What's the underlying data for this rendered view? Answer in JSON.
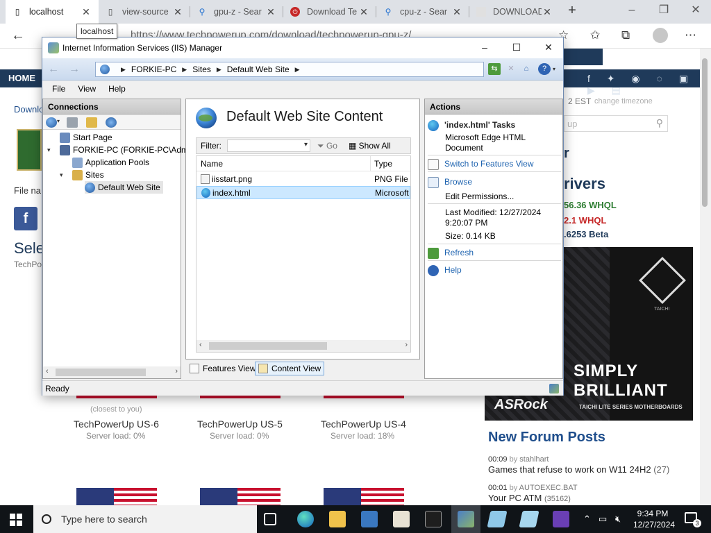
{
  "browser": {
    "tabs": [
      {
        "label": "localhost",
        "active": true,
        "icon": "page-icon"
      },
      {
        "label": "view-source",
        "active": false,
        "icon": "page-icon"
      },
      {
        "label": "gpu-z - Sear",
        "active": false,
        "icon": "search-icon"
      },
      {
        "label": "Download Te",
        "active": false,
        "icon": "techpowerup-icon"
      },
      {
        "label": "cpu-z - Sear",
        "active": false,
        "icon": "search-icon"
      },
      {
        "label": "DOWNLOAD",
        "active": false,
        "icon": "site-icon"
      }
    ],
    "close_glyph": "✕",
    "url": "https://www.techpowerup.com/download/techpowerup-gpu-z/",
    "tooltip": "localhost"
  },
  "page": {
    "nav_home": "HOME",
    "download_text": "Downlo",
    "file_text": "File na",
    "select_text": "Sele",
    "techpo_text": "TechPo",
    "time_zone_prefix": "2 EST",
    "change_timezone": "change timezone",
    "search_placeholder": "up",
    "drivers_heading": "rivers",
    "drivers": [
      {
        "text": "56.36 WHQL",
        "color": "#2e7d32"
      },
      {
        "text": "2.1 WHQL",
        "color": "#c62828"
      },
      {
        "text": ".6253 Beta",
        "color": "#1f3a5a"
      }
    ],
    "r_fragment": "r",
    "ad": {
      "line1": "SIMPLY",
      "line2": "BRILLIANT",
      "brand": "ASRock",
      "sub": "TAICHI LITE SERIES MOTHERBOARDS",
      "taichi": "TAICHI"
    },
    "closest_note": "(closest to you)",
    "servers": [
      {
        "name": "TechPowerUp US-6",
        "load": "Server load: 0%"
      },
      {
        "name": "TechPowerUp US-5",
        "load": "Server load: 0%"
      },
      {
        "name": "TechPowerUp US-4",
        "load": "Server load: 18%"
      }
    ],
    "forum_heading": "New Forum Posts",
    "forum_posts": [
      {
        "time": "00:09",
        "by": "by",
        "user": "stahlhart",
        "title": "Games that refuse to work on W11 24H2",
        "count": "(27)"
      },
      {
        "time": "00:01",
        "by": "by",
        "user": "AUTOEXEC.BAT",
        "title": "Your PC ATM",
        "count": "(35162)"
      }
    ]
  },
  "iis": {
    "title": "Internet Information Services (IIS) Manager",
    "breadcrumb": [
      "FORKIE-PC",
      "Sites",
      "Default Web Site"
    ],
    "menu": [
      "File",
      "View",
      "Help"
    ],
    "connections": {
      "header": "Connections",
      "tree": [
        {
          "label": "Start Page",
          "level": 0,
          "expander": "",
          "icon_color": "#6a8bbd"
        },
        {
          "label": "FORKIE-PC (FORKIE-PC\\Adm",
          "level": 0,
          "expander": "▾",
          "icon_color": "#4d6a99"
        },
        {
          "label": "Application Pools",
          "level": 1,
          "expander": "",
          "icon_color": "#8aa7cf"
        },
        {
          "label": "Sites",
          "level": 1,
          "expander": "▾",
          "icon_color": "#d9b04a"
        },
        {
          "label": "Default Web Site",
          "level": 2,
          "expander": "",
          "icon_color": "#2f7ad0",
          "selected": true
        }
      ]
    },
    "content": {
      "title": "Default Web Site Content",
      "filter_label": "Filter:",
      "go_label": "Go",
      "show_all_label": "Show All",
      "columns": [
        "Name",
        "Type"
      ],
      "rows": [
        {
          "name": "iisstart.png",
          "type": "PNG File",
          "selected": false
        },
        {
          "name": "index.html",
          "type": "Microsoft",
          "selected": true
        }
      ],
      "tabs": [
        {
          "label": "Features View",
          "active": false
        },
        {
          "label": "Content View",
          "active": true
        }
      ]
    },
    "actions": {
      "header": "Actions",
      "task_title": "'index.html' Tasks",
      "task_desc_1": "Microsoft Edge HTML",
      "task_desc_2": "Document",
      "switch_link": "Switch to Features View",
      "browse_link": "Browse",
      "edit_permissions_link": "Edit Permissions...",
      "last_modified_1": "Last Modified: 12/27/2024",
      "last_modified_2": "9:20:07 PM",
      "size": "Size: 0.14 KB",
      "refresh_link": "Refresh",
      "help_link": "Help"
    },
    "status": "Ready"
  },
  "taskbar": {
    "search_placeholder": "Type here to search",
    "time": "9:34 PM",
    "date": "12/27/2024",
    "notification_count": "3"
  }
}
